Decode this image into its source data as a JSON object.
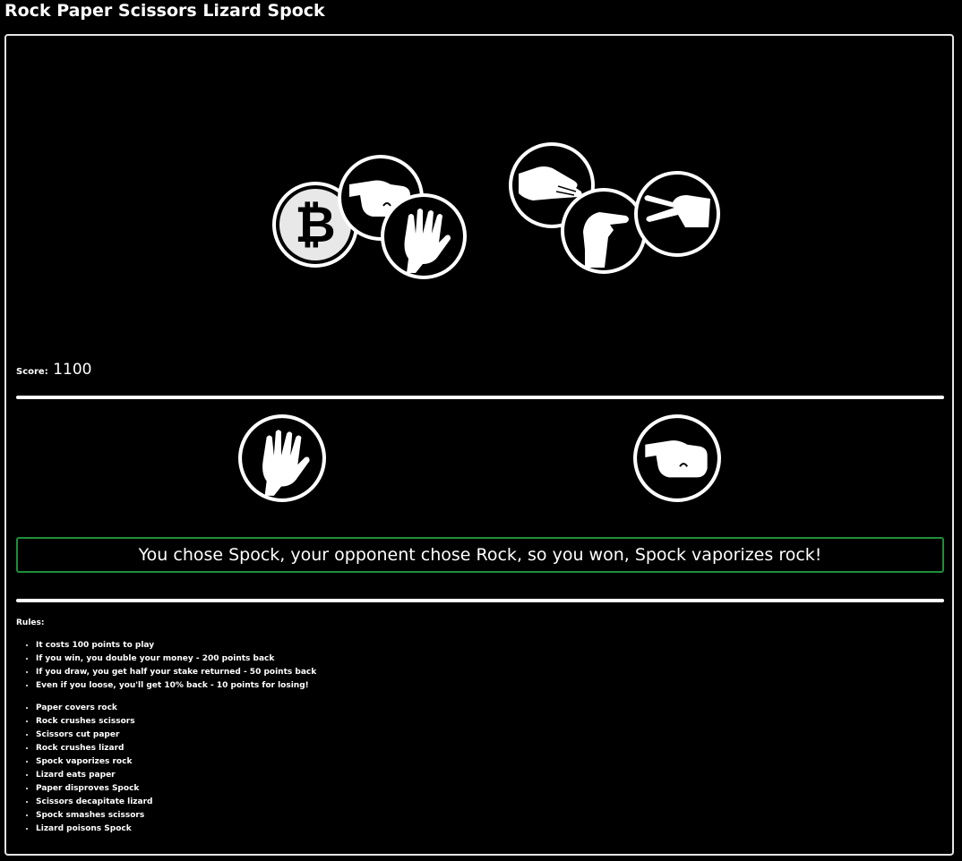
{
  "page": {
    "title": "Rock Paper Scissors Lizard Spock"
  },
  "choices": [
    {
      "id": "bitcoin",
      "icon": "bitcoin-icon"
    },
    {
      "id": "rock",
      "icon": "rock-fist-icon"
    },
    {
      "id": "spock",
      "icon": "spock-hand-icon"
    },
    {
      "id": "paper",
      "icon": "paper-hand-icon"
    },
    {
      "id": "lizard",
      "icon": "lizard-hand-icon"
    },
    {
      "id": "scissors",
      "icon": "scissors-hand-icon"
    }
  ],
  "score": {
    "label": "Score:",
    "value": "1100"
  },
  "round": {
    "player_icon": "spock-hand-icon",
    "opponent_icon": "rock-fist-icon"
  },
  "result": {
    "text": "You chose Spock, your opponent chose Rock, so you won, Spock vaporizes rock!",
    "border_color": "#1f8f3a"
  },
  "rules": {
    "heading": "Rules:",
    "payout": [
      "It costs 100 points to play",
      "If you win, you double your money - 200 points back",
      "If you draw, you get half your stake returned - 50 points back",
      "Even if you loose, you'll get 10% back - 10 points for losing!"
    ],
    "outcomes": [
      "Paper covers rock",
      "Rock crushes scissors",
      "Scissors cut paper",
      "Rock crushes lizard",
      "Spock vaporizes rock",
      "Lizard eats paper",
      "Paper disproves Spock",
      "Scissors decapitate lizard",
      "Spock smashes scissors",
      "Lizard poisons Spock"
    ]
  },
  "colors": {
    "background": "#000000",
    "foreground": "#ffffff",
    "win": "#1f8f3a"
  }
}
